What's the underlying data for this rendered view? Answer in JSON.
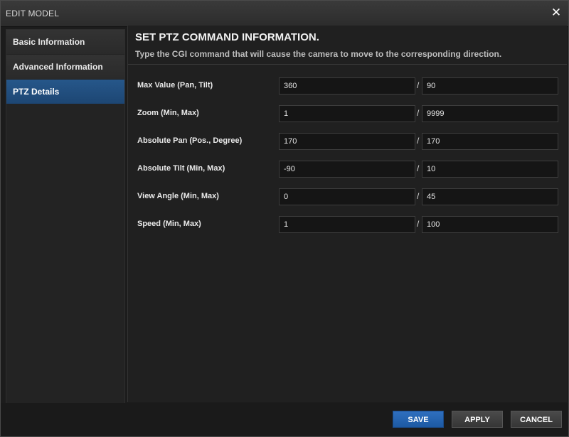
{
  "window": {
    "title": "EDIT MODEL",
    "close_icon": "close-icon"
  },
  "sidebar": {
    "items": [
      {
        "label": "Basic Information",
        "active": false
      },
      {
        "label": "Advanced Information",
        "active": false
      },
      {
        "label": "PTZ Details",
        "active": true
      }
    ]
  },
  "main": {
    "heading": "SET PTZ COMMAND INFORMATION.",
    "subheading": "Type the CGI command that will cause the camera to move to the corresponding direction.",
    "separator_glyph": "/",
    "rows": [
      {
        "label": "Max Value (Pan, Tilt)",
        "min": "360",
        "max": "90"
      },
      {
        "label": "Zoom (Min, Max)",
        "min": "1",
        "max": "9999"
      },
      {
        "label": "Absolute Pan (Pos., Degree)",
        "min": "170",
        "max": "170"
      },
      {
        "label": "Absolute Tilt (Min, Max)",
        "min": "-90",
        "max": "10"
      },
      {
        "label": "View Angle (Min, Max)",
        "min": "0",
        "max": "45"
      },
      {
        "label": "Speed (Min, Max)",
        "min": "1",
        "max": "100"
      }
    ]
  },
  "footer": {
    "save_label": "SAVE",
    "apply_label": "APPLY",
    "cancel_label": "CANCEL"
  },
  "colors": {
    "accent": "#1d5aa3",
    "active_nav": "#1d4673"
  }
}
